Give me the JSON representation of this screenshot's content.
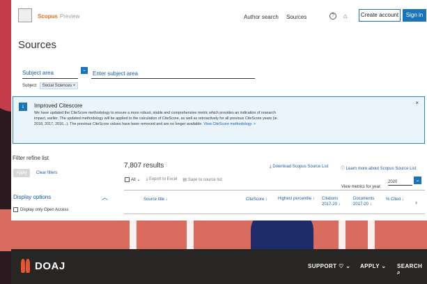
{
  "scopus": {
    "brand": "Scopus",
    "brand_suffix": "Preview",
    "nav": {
      "author_search": "Author search",
      "sources": "Sources"
    },
    "create_account": "Create account",
    "sign_in": "Sign in",
    "page_title": "Sources",
    "subject_area_label": "Subject area",
    "subject_placeholder": "Enter subject area",
    "subject_prefix": "Subject:",
    "subject_tag": "Social Sciences ×",
    "notice": {
      "title": "Improved Citescore",
      "text": "We have updated the CiteScore methodology to ensure a more robust, stable and comprehensive metric which provides an indication of research impact, earlier. The updated methodology will be applied to the calculation of CiteScore, as well as retroactively for all previous CiteScore years (ie. 2018, 2017, 2016...). The previous CiteScore values have been removed and are no longer available.",
      "link": "View CiteScore methodology. >",
      "close": "×"
    },
    "filter": {
      "title": "Filter refine list",
      "apply": "Apply",
      "clear": "Clear filters",
      "display_options": "Display options",
      "open_access": "Display only Open Access"
    },
    "results": {
      "count": "7,807 results",
      "download": "Download Scopus Source List",
      "learn_more": "Learn more about Scopus Source List",
      "all": "All",
      "export": "Export to Excel",
      "save": "Save to source list",
      "metrics_label": "View metrics for year:",
      "year": "2020",
      "columns": [
        "Source title ↓",
        "CiteScore ↓",
        "Highest percentile ↓",
        "Citations 2017-20 ↓",
        "Documents 2017-20 ↓",
        "% Cited ↓"
      ]
    }
  },
  "doaj": {
    "brand": "DOAJ",
    "nav": [
      "SUPPORT ♡ ⌄",
      "APPLY ⌄",
      "SEARCH ⌕"
    ]
  },
  "colors": {
    "scopus_blue": "#1a74b8",
    "scopus_orange": "#e9711c",
    "doaj_orange": "#e8562d",
    "doaj_bar": "#282624"
  }
}
